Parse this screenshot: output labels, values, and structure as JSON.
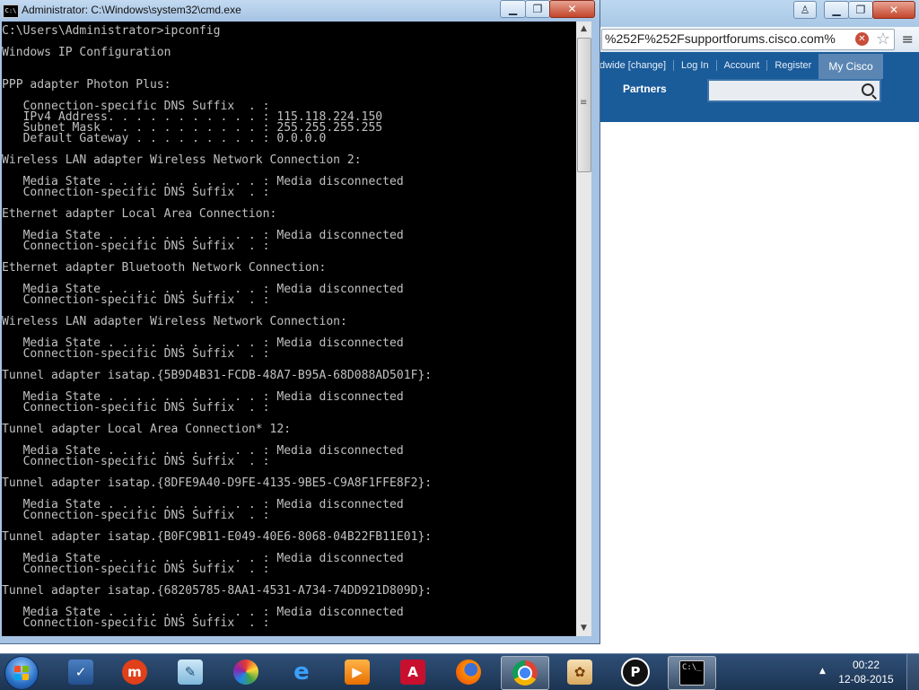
{
  "cmd": {
    "title": "Administrator: C:\\Windows\\system32\\cmd.exe",
    "icon_text": "C:\\",
    "output": [
      "C:\\Users\\Administrator>ipconfig",
      "",
      "Windows IP Configuration",
      "",
      "",
      "PPP adapter Photon Plus:",
      "",
      "   Connection-specific DNS Suffix  . :",
      "   IPv4 Address. . . . . . . . . . . : 115.118.224.150",
      "   Subnet Mask . . . . . . . . . . . : 255.255.255.255",
      "   Default Gateway . . . . . . . . . : 0.0.0.0",
      "",
      "Wireless LAN adapter Wireless Network Connection 2:",
      "",
      "   Media State . . . . . . . . . . . : Media disconnected",
      "   Connection-specific DNS Suffix  . :",
      "",
      "Ethernet adapter Local Area Connection:",
      "",
      "   Media State . . . . . . . . . . . : Media disconnected",
      "   Connection-specific DNS Suffix  . :",
      "",
      "Ethernet adapter Bluetooth Network Connection:",
      "",
      "   Media State . . . . . . . . . . . : Media disconnected",
      "   Connection-specific DNS Suffix  . :",
      "",
      "Wireless LAN adapter Wireless Network Connection:",
      "",
      "   Media State . . . . . . . . . . . : Media disconnected",
      "   Connection-specific DNS Suffix  . :",
      "",
      "Tunnel adapter isatap.{5B9D4B31-FCDB-48A7-B95A-68D088AD501F}:",
      "",
      "   Media State . . . . . . . . . . . : Media disconnected",
      "   Connection-specific DNS Suffix  . :",
      "",
      "Tunnel adapter Local Area Connection* 12:",
      "",
      "   Media State . . . . . . . . . . . : Media disconnected",
      "   Connection-specific DNS Suffix  . :",
      "",
      "Tunnel adapter isatap.{8DFE9A40-D9FE-4135-9BE5-C9A8F1FFE8F2}:",
      "",
      "   Media State . . . . . . . . . . . : Media disconnected",
      "   Connection-specific DNS Suffix  . :",
      "",
      "Tunnel adapter isatap.{B0FC9B11-E049-40E6-8068-04B22FB11E01}:",
      "",
      "   Media State . . . . . . . . . . . : Media disconnected",
      "   Connection-specific DNS Suffix  . :",
      "",
      "Tunnel adapter isatap.{68205785-8AA1-4531-A734-74DD921D809D}:",
      "",
      "   Media State . . . . . . . . . . . : Media disconnected",
      "   Connection-specific DNS Suffix  . :"
    ]
  },
  "browser": {
    "url": "%252F%252Fsupportforums.cisco.com%",
    "links": [
      "dwide [change]",
      "Log In",
      "Account",
      "Register"
    ],
    "my_cisco": "My Cisco",
    "partners": "Partners",
    "search_placeholder": ""
  },
  "taskbar": {
    "time": "00:22",
    "date": "12-08-2015",
    "cmd_icon_text": "C:\\_"
  },
  "window_buttons": {
    "minimize": "▁",
    "restore": "❐",
    "close": "✕"
  },
  "colors": {
    "console_bg": "#000000",
    "console_fg": "#c0c0c0",
    "cisco_blue": "#1a5b9a",
    "taskbar": "#1c3452"
  }
}
